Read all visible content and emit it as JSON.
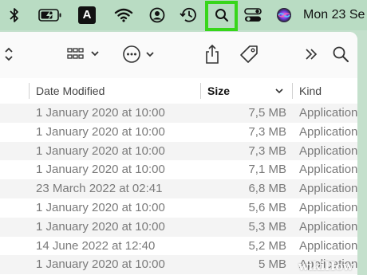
{
  "menubar": {
    "icons": [
      "bluetooth-icon",
      "battery-charging-icon",
      "keyboard-input-icon",
      "wifi-icon",
      "user-icon",
      "time-machine-icon",
      "spotlight-search-icon",
      "control-center-icon",
      "siri-icon"
    ],
    "input_source_label": "A",
    "clock": "Mon 23 Se",
    "highlight_color": "#37d61a"
  },
  "toolbar": {
    "icons": [
      "sidebar-chevron-icon",
      "group-view-icon",
      "action-menu-icon",
      "share-icon",
      "tag-icon",
      "more-chevrons-icon",
      "search-icon"
    ]
  },
  "columns": {
    "date_modified": "Date Modified",
    "size": "Size",
    "kind": "Kind"
  },
  "rows": [
    {
      "date": "1 January 2020 at 10:00",
      "size": "7,5 MB",
      "kind": "Application"
    },
    {
      "date": "1 January 2020 at 10:00",
      "size": "7,3 MB",
      "kind": "Application"
    },
    {
      "date": "1 January 2020 at 10:00",
      "size": "7,3 MB",
      "kind": "Application"
    },
    {
      "date": "1 January 2020 at 10:00",
      "size": "7,1 MB",
      "kind": "Application"
    },
    {
      "date": "23 March 2022 at 02:41",
      "size": "6,8 MB",
      "kind": "Application"
    },
    {
      "date": "1 January 2020 at 10:00",
      "size": "5,6 MB",
      "kind": "Application"
    },
    {
      "date": "1 January 2020 at 10:00",
      "size": "5,3 MB",
      "kind": "Application"
    },
    {
      "date": "14 June 2022 at 12:40",
      "size": "5,2 MB",
      "kind": "Application"
    },
    {
      "date": "1 January 2020 at 10:00",
      "size": "5 MB",
      "kind": "Application"
    }
  ],
  "watermark": "wikiHow"
}
